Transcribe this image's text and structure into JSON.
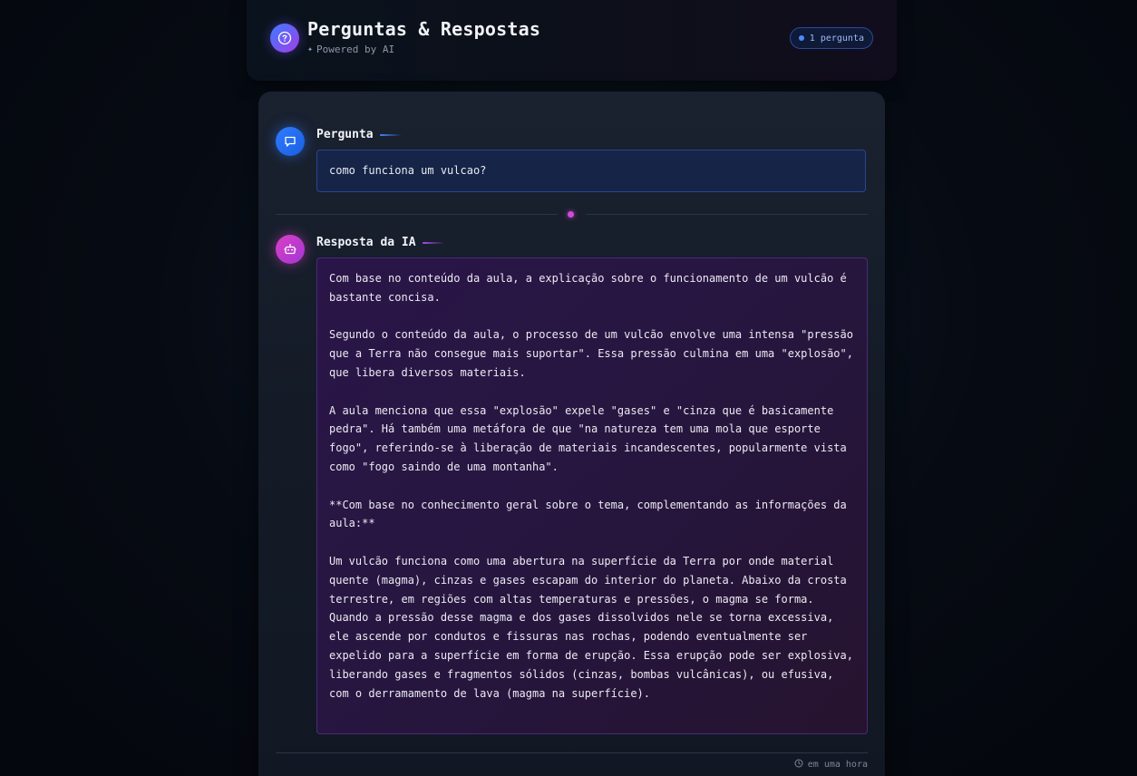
{
  "header": {
    "title": "Perguntas & Respostas",
    "subtitle": "Powered by AI",
    "logo_icon": "question-circle-icon",
    "sparkle_icon": "sparkles-icon",
    "badge": "1 pergunta"
  },
  "question": {
    "label": "Pergunta",
    "icon": "chat-bubble-icon",
    "text": "como funciona um vulcao?"
  },
  "answer": {
    "label": "Resposta da IA",
    "icon": "robot-icon",
    "paragraphs": [
      "Com base no conteúdo da aula, a explicação sobre o funcionamento de um vulcão é bastante concisa.",
      "Segundo o conteúdo da aula, o processo de um vulcão envolve uma intensa \"pressão que a Terra não consegue mais suportar\". Essa pressão culmina em uma \"explosão\", que libera diversos materiais.",
      "A aula menciona que essa \"explosão\" expele \"gases\" e \"cinza que é basicamente pedra\". Há também uma metáfora de que \"na natureza tem uma mola que esporte fogo\", referindo-se à liberação de materiais incandescentes, popularmente vista como \"fogo saindo de uma montanha\".",
      "**Com base no conhecimento geral sobre o tema, complementando as informações da aula:**",
      "Um vulcão funciona como uma abertura na superfície da Terra por onde material quente (magma), cinzas e gases escapam do interior do planeta. Abaixo da crosta terrestre, em regiões com altas temperaturas e pressões, o magma se forma. Quando a pressão desse magma e dos gases dissolvidos nele se torna excessiva, ele ascende por condutos e fissuras nas rochas, podendo eventualmente ser expelido para a superfície em forma de erupção. Essa erupção pode ser explosiva, liberando gases e fragmentos sólidos (cinzas, bombas vulcânicas), ou efusiva, com o derramamento de lava (magma na superfície)."
    ]
  },
  "footer": {
    "time": "em uma hora",
    "clock_icon": "clock-icon"
  },
  "colors": {
    "accent_blue": "#2f7bff",
    "accent_magenta": "#d940c4"
  }
}
